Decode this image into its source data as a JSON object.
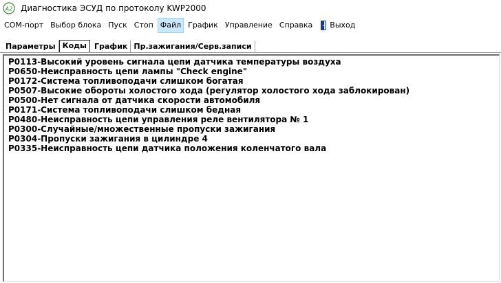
{
  "window": {
    "title": "Диагностика ЭСУД по протоколу KWP2000",
    "icon": "a2-app-icon"
  },
  "menu": {
    "items": [
      {
        "label": "COM-порт",
        "active": false
      },
      {
        "label": "Выбор блока",
        "active": false
      },
      {
        "label": "Пуск",
        "active": false
      },
      {
        "label": "Стоп",
        "active": false
      },
      {
        "label": "Файл",
        "active": true
      },
      {
        "label": "График",
        "active": false
      },
      {
        "label": "Управление",
        "active": false
      },
      {
        "label": "Справка",
        "active": false
      },
      {
        "label": "Выход",
        "active": false,
        "icon": "door-exit-icon"
      }
    ]
  },
  "tabs": [
    {
      "label": "Параметры",
      "active": false
    },
    {
      "label": "Коды",
      "active": true
    },
    {
      "label": "График",
      "active": false
    },
    {
      "label": "Пр.зажигания/Серв.записи",
      "active": false
    }
  ],
  "codes": [
    "P0113-Высокий уровень сигнала цепи датчика температуры воздуха",
    "P0650-Неисправность цепи лампы \"Check engine\"",
    "P0172-Система топливоподачи слишком богатая",
    "P0507-Высокие обороты холостого хода (регулятор холостого хода заблокирован)",
    "P0500-Нет сигнала от датчика скорости автомобиля",
    "P0171-Система топливоподачи слишком бедная",
    "P0480-Неисправность цепи управления реле вентилятора № 1",
    "P0300-Случайные/множественные пропуски зажигания",
    "P0304-Пропуски зажигания в цилиндре 4",
    "P0335-Неисправность цепи датчика положения коленчатого вала"
  ],
  "colors": {
    "active_menu_bg": "#cce8ff",
    "active_menu_border": "#99d1ff",
    "icon_green": "#3a8a3a",
    "exit_icon_blue": "#1a3a8c"
  }
}
